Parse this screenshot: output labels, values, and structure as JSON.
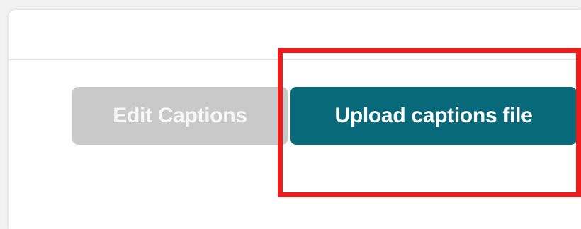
{
  "dialog": {
    "buttons": {
      "edit_captions_label": "Edit Captions",
      "upload_captions_label": "Upload captions file"
    }
  },
  "colors": {
    "upload_button_bg": "#07697a",
    "edit_button_bg": "#c9c9c9",
    "highlight_border": "#ee1c1c"
  }
}
